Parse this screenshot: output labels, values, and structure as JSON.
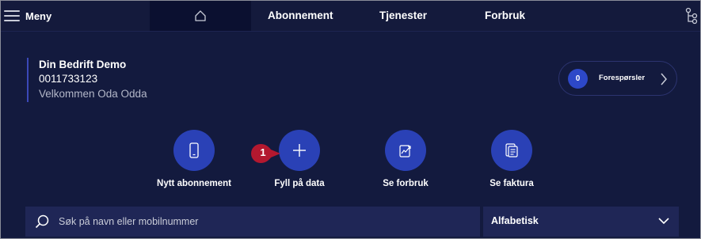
{
  "nav": {
    "menu_label": "Meny",
    "tabs": [
      {
        "label": "Abonnement"
      },
      {
        "label": "Tjenester"
      },
      {
        "label": "Forbruk"
      }
    ]
  },
  "company": {
    "name": "Din Bedrift Demo",
    "number": "0011733123",
    "welcome": "Velkommen Oda Odda"
  },
  "requests": {
    "count": "0",
    "label": "Forespørsler"
  },
  "actions": [
    {
      "label": "Nytt abonnement",
      "icon": "phone-icon"
    },
    {
      "label": "Fyll på data",
      "icon": "plus-icon"
    },
    {
      "label": "Se forbruk",
      "icon": "usage-chart-icon"
    },
    {
      "label": "Se faktura",
      "icon": "invoice-icon"
    }
  ],
  "step_marker": {
    "number": "1",
    "color": "#b3182f"
  },
  "search": {
    "placeholder": "Søk på navn eller mobilnummer",
    "value": ""
  },
  "sort": {
    "selected": "Alfabetisk"
  },
  "colors": {
    "background": "#131a3e",
    "accent": "#2a41b6",
    "panel": "#1f2656"
  }
}
